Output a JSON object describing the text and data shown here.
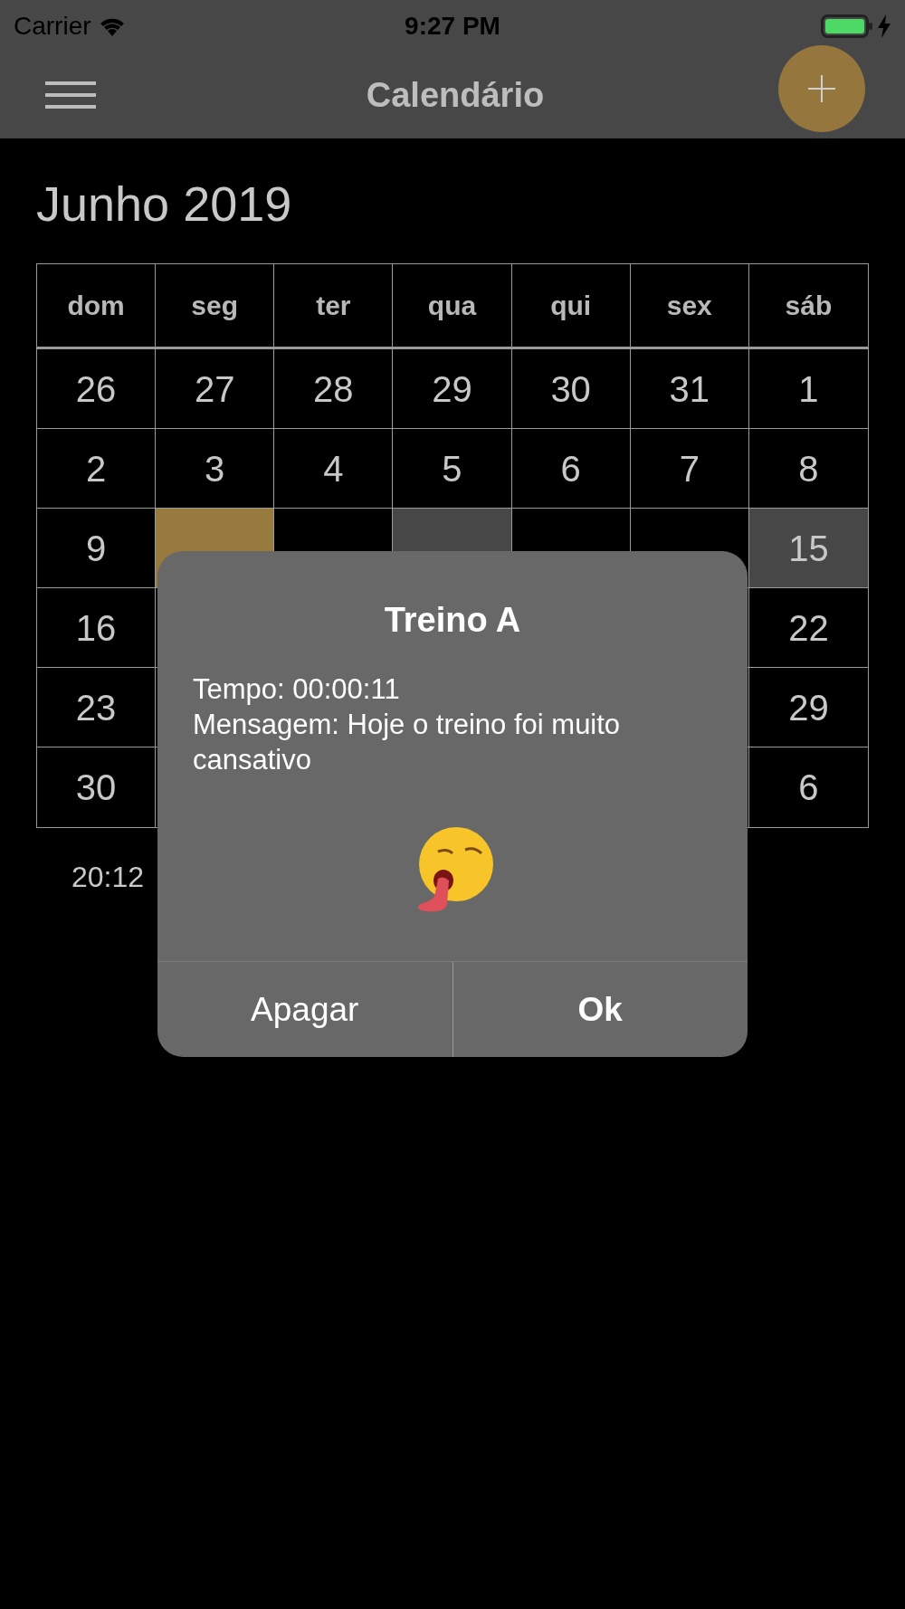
{
  "status_bar": {
    "carrier": "Carrier",
    "time": "9:27 PM",
    "charging": true
  },
  "nav_bar": {
    "title": "Calendário"
  },
  "month_title": "Junho 2019",
  "weekdays": [
    "dom",
    "seg",
    "ter",
    "qua",
    "qui",
    "sex",
    "sáb"
  ],
  "weeks": [
    {
      "cells": [
        {
          "day": "26",
          "kind": "normal"
        },
        {
          "day": "27",
          "kind": "normal"
        },
        {
          "day": "28",
          "kind": "normal"
        },
        {
          "day": "29",
          "kind": "normal"
        },
        {
          "day": "30",
          "kind": "normal"
        },
        {
          "day": "31",
          "kind": "normal"
        },
        {
          "day": "1",
          "kind": "normal"
        }
      ]
    },
    {
      "cells": [
        {
          "day": "2",
          "kind": "normal"
        },
        {
          "day": "3",
          "kind": "normal"
        },
        {
          "day": "4",
          "kind": "normal"
        },
        {
          "day": "5",
          "kind": "normal"
        },
        {
          "day": "6",
          "kind": "normal"
        },
        {
          "day": "7",
          "kind": "normal"
        },
        {
          "day": "8",
          "kind": "normal"
        }
      ]
    },
    {
      "cells": [
        {
          "day": "9",
          "kind": "normal"
        },
        {
          "kind": "today"
        },
        {
          "kind": "normal"
        },
        {
          "kind": "event"
        },
        {
          "kind": "normal"
        },
        {
          "kind": "normal"
        },
        {
          "day": "15",
          "kind": "event"
        }
      ]
    },
    {
      "cells": [
        {
          "day": "16",
          "kind": "normal"
        },
        {
          "day": "22",
          "kind": "normal"
        }
      ]
    },
    {
      "cells": [
        {
          "day": "23",
          "kind": "normal"
        },
        {
          "day": "29",
          "kind": "normal"
        }
      ]
    },
    {
      "cells": [
        {
          "day": "30",
          "kind": "normal"
        },
        {
          "day": "6",
          "kind": "normal"
        }
      ]
    }
  ],
  "event_time": "20:12",
  "dialog": {
    "title": "Treino A",
    "lines": [
      "Tempo: 00:00:11",
      "Mensagem: Hoje o treino foi muito cansativo"
    ],
    "buttons": [
      {
        "label": "Apagar",
        "kind": "normal"
      },
      {
        "label": "Ok",
        "kind": "default"
      }
    ]
  }
}
